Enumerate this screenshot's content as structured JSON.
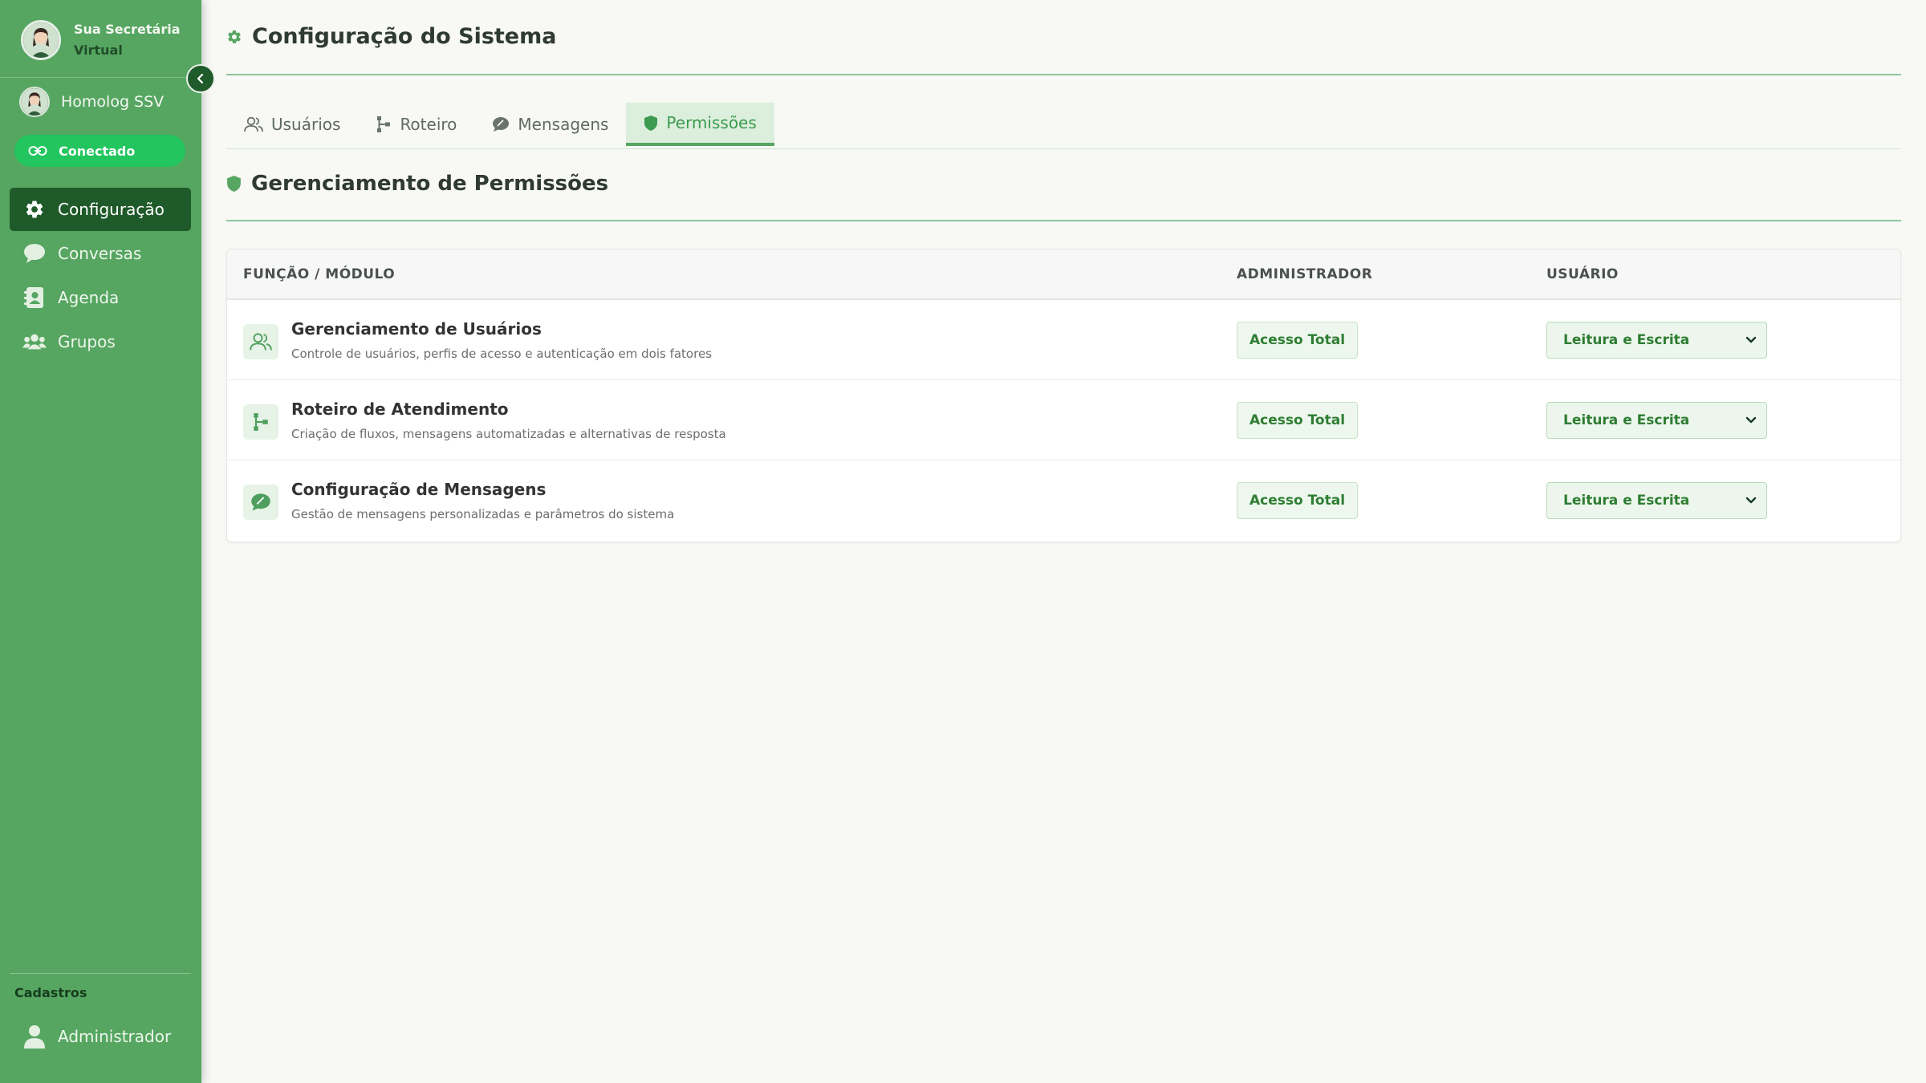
{
  "sidebar": {
    "brand": {
      "line1": "Sua Secretária",
      "line2": "Virtual"
    },
    "account": {
      "name": "Homolog SSV"
    },
    "status": {
      "label": "Conectado",
      "color": "#22c55e"
    },
    "nav": [
      {
        "label": "Configuração",
        "icon": "gear-icon",
        "active": true
      },
      {
        "label": "Conversas",
        "icon": "chat-bubble-icon",
        "active": false
      },
      {
        "label": "Agenda",
        "icon": "contact-book-icon",
        "active": false
      },
      {
        "label": "Grupos",
        "icon": "users-icon",
        "active": false
      }
    ],
    "section_label": "Cadastros",
    "admin_item": {
      "label": "Administrador",
      "icon": "user-icon"
    }
  },
  "page": {
    "title": "Configuração do Sistema",
    "tabs": [
      {
        "label": "Usuários",
        "icon": "users-outline-icon",
        "active": false
      },
      {
        "label": "Roteiro",
        "icon": "flow-icon",
        "active": false
      },
      {
        "label": "Mensagens",
        "icon": "message-icon",
        "active": false
      },
      {
        "label": "Permissões",
        "icon": "shield-icon",
        "active": true
      }
    ],
    "section_title": "Gerenciamento de Permissões"
  },
  "table": {
    "columns": [
      "FUNÇÃO / MÓDULO",
      "ADMINISTRADOR",
      "USUÁRIO"
    ],
    "rows": [
      {
        "title": "Gerenciamento de Usuários",
        "description": "Controle de usuários, perfis de acesso e autenticação em dois fatores",
        "icon": "users-outline-icon",
        "admin": "Acesso Total",
        "user": "Leitura e Escrita"
      },
      {
        "title": "Roteiro de Atendimento",
        "description": "Criação de fluxos, mensagens automatizadas e alternativas de resposta",
        "icon": "flow-icon",
        "admin": "Acesso Total",
        "user": "Leitura e Escrita"
      },
      {
        "title": "Configuração de Mensagens",
        "description": "Gestão de mensagens personalizadas e parâmetros do sistema",
        "icon": "message-icon",
        "admin": "Acesso Total",
        "user": "Leitura e Escrita"
      }
    ]
  },
  "colors": {
    "sidebar": "#56a661",
    "accent_dark": "#1f5a2a",
    "accent": "#3d9a50"
  }
}
